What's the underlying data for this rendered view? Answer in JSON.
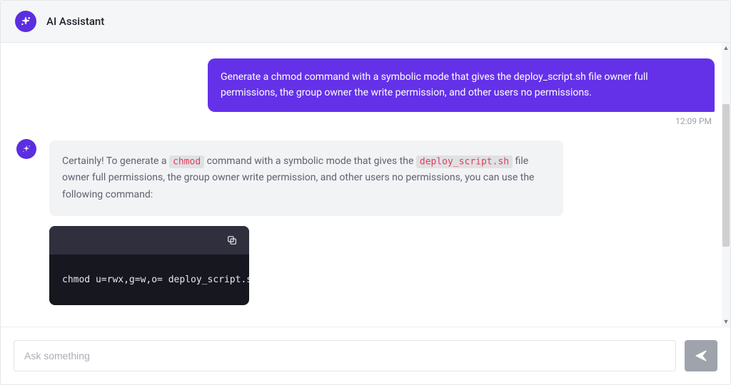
{
  "header": {
    "title": "AI Assistant"
  },
  "messages": {
    "user": {
      "text": "Generate a chmod command with a symbolic mode that gives the deploy_script.sh file owner full permissions, the group owner the write permission, and other users no permissions.",
      "timestamp": "12:09 PM"
    },
    "assistant": {
      "p1_a": "Certainly! To generate a ",
      "code1": "chmod",
      "p1_b": " command with a symbolic mode that gives the ",
      "code2": "deploy_script.sh",
      "p1_c": " file owner full permissions, the group owner write permission, and other users no permissions, you can use the following command:",
      "codeblock": "chmod u=rwx,g=w,o= deploy_script.sh"
    }
  },
  "composer": {
    "placeholder": "Ask something",
    "value": ""
  },
  "icons": {
    "sparkle": "sparkle-icon",
    "copy": "copy-icon",
    "send": "send-icon"
  }
}
